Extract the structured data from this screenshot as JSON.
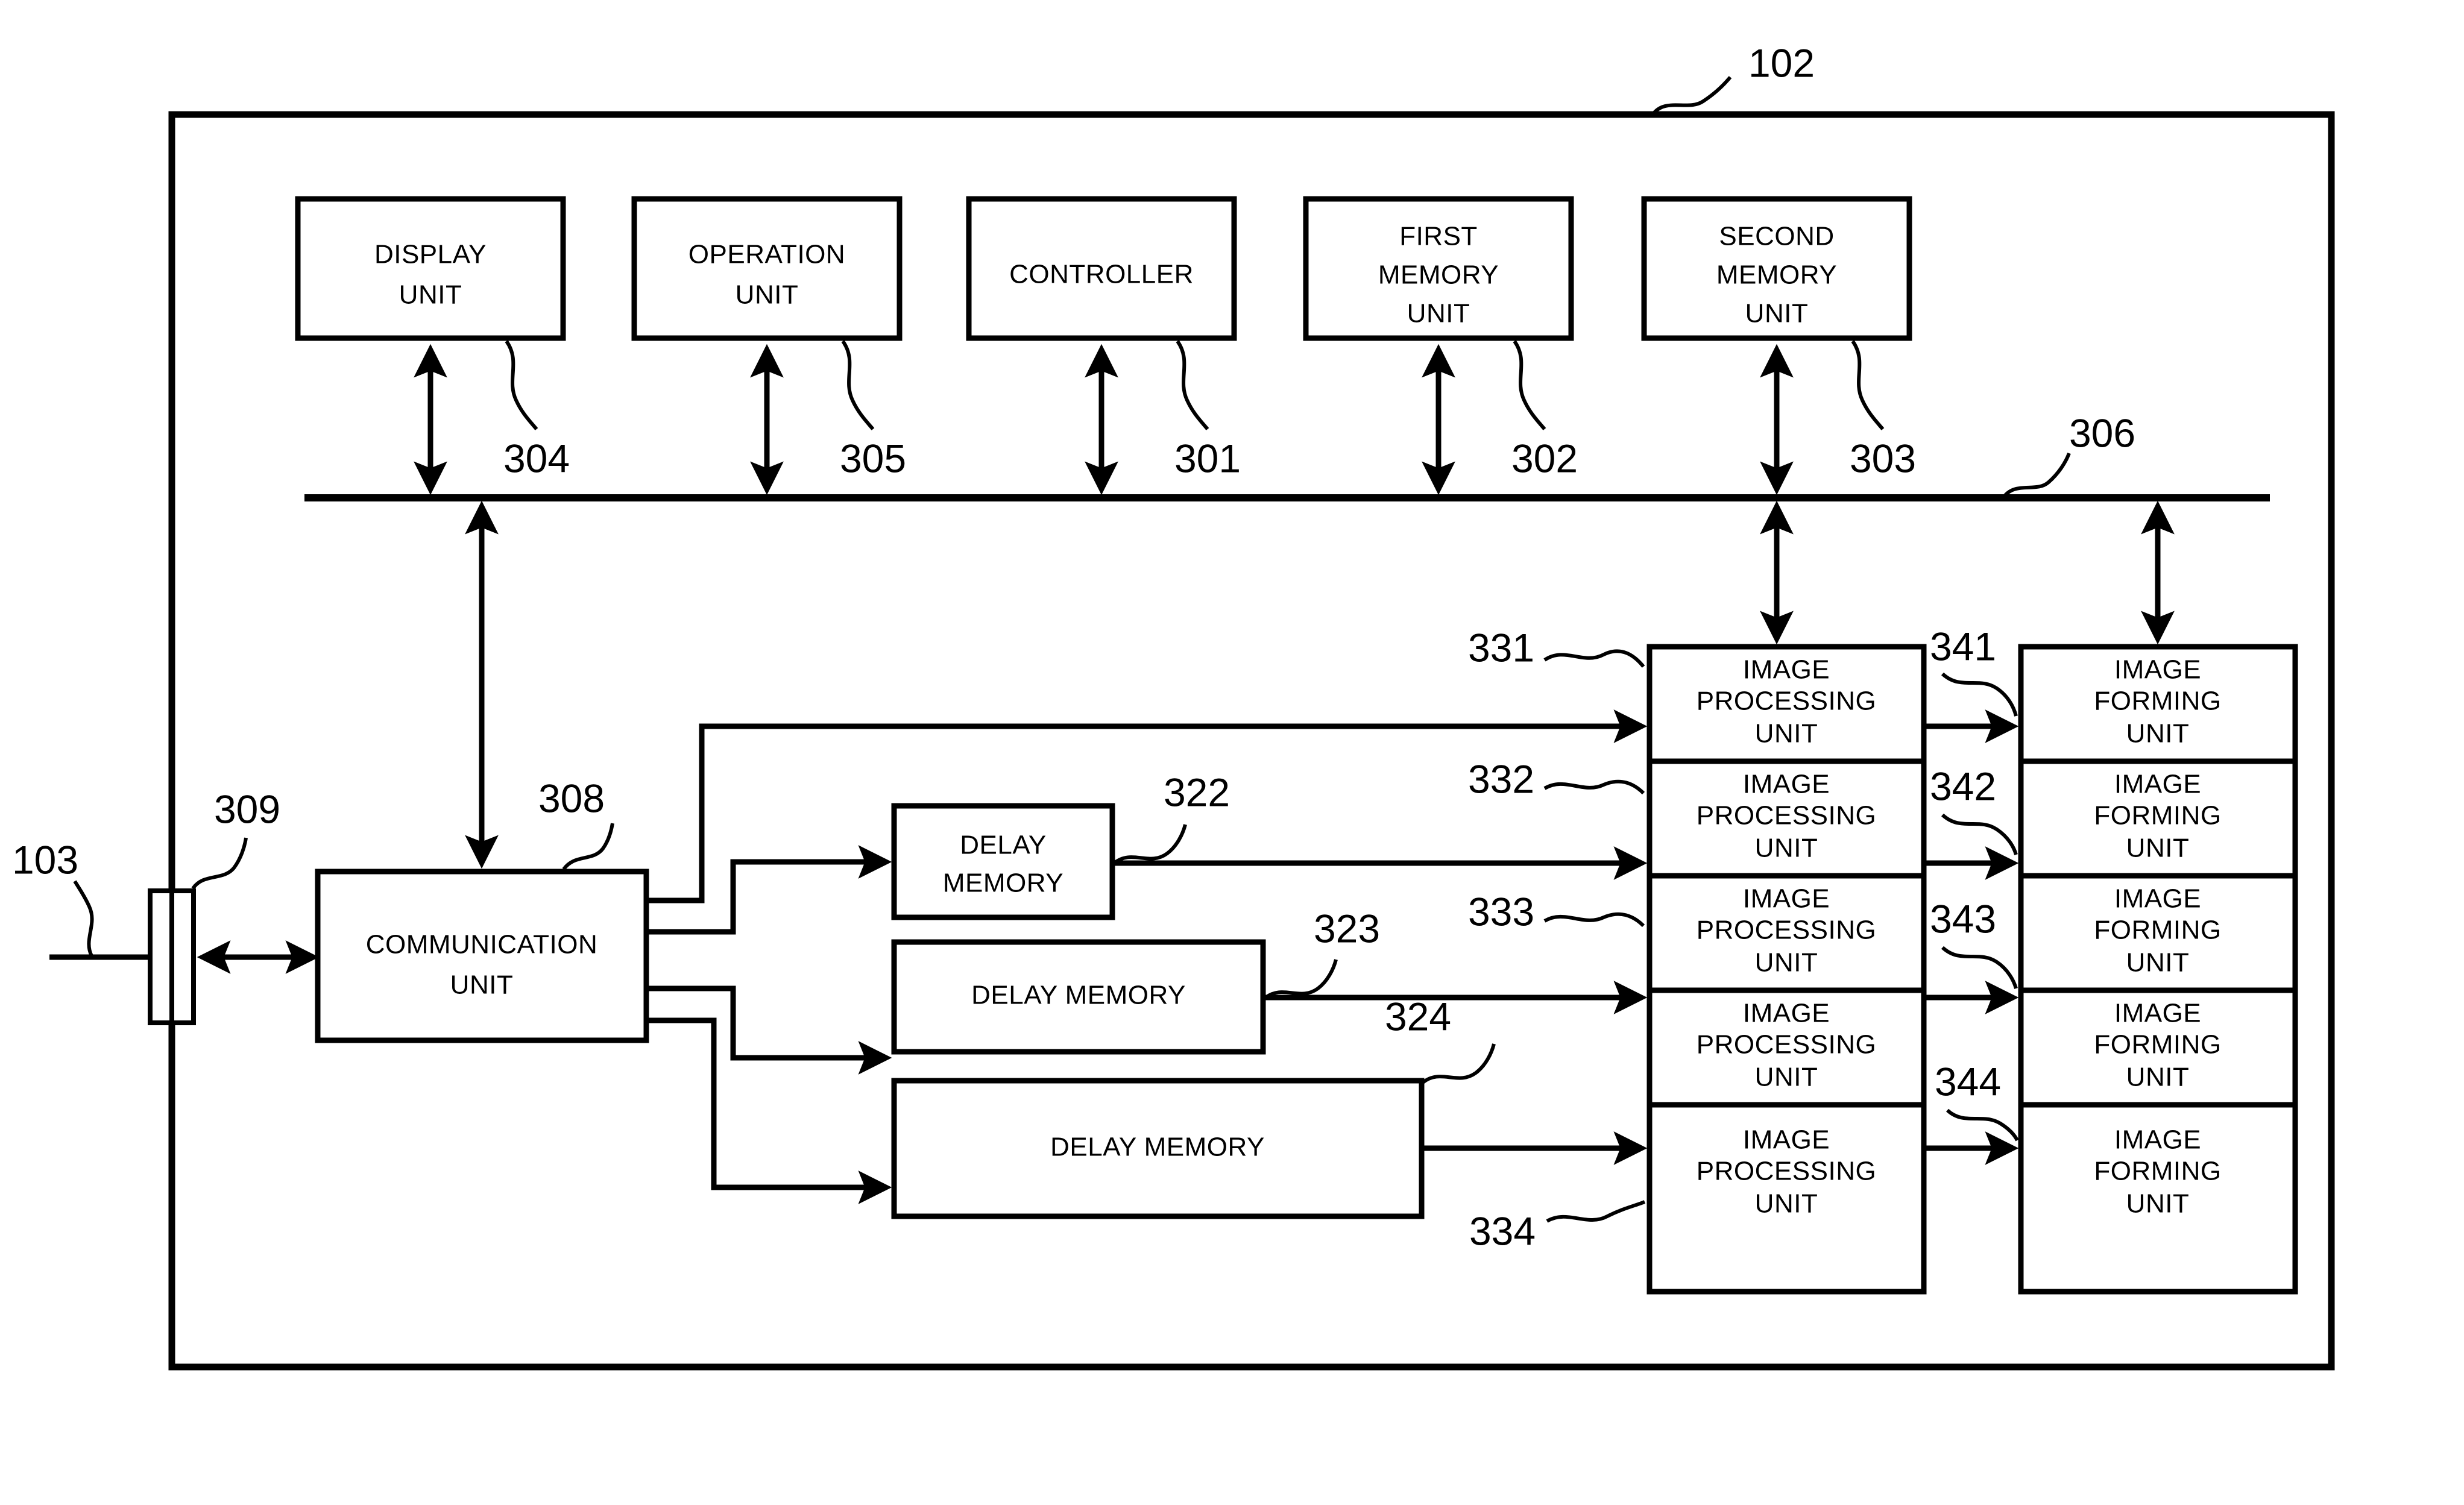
{
  "figure": {
    "outer_ref": "102",
    "external_ref": "103",
    "bus_ref": "306",
    "connector_ref": "309"
  },
  "top_row": [
    {
      "label_line1": "DISPLAY",
      "label_line2": "UNIT",
      "label_line3": "",
      "ref": "304"
    },
    {
      "label_line1": "OPERATION",
      "label_line2": "UNIT",
      "label_line3": "",
      "ref": "305"
    },
    {
      "label_line1": "CONTROLLER",
      "label_line2": "",
      "label_line3": "",
      "ref": "301"
    },
    {
      "label_line1": "FIRST",
      "label_line2": "MEMORY",
      "label_line3": "UNIT",
      "ref": "302"
    },
    {
      "label_line1": "SECOND",
      "label_line2": "MEMORY",
      "label_line3": "UNIT",
      "ref": "303"
    }
  ],
  "communication_unit": {
    "label_line1": "COMMUNICATION",
    "label_line2": "UNIT",
    "ref": "308"
  },
  "delay_memories": [
    {
      "label_line1": "DELAY",
      "label_line2": "MEMORY",
      "single_line": "",
      "ref": "322"
    },
    {
      "label_line1": "",
      "label_line2": "",
      "single_line": "DELAY MEMORY",
      "ref": "323"
    },
    {
      "label_line1": "",
      "label_line2": "",
      "single_line": "DELAY MEMORY",
      "ref": "324"
    }
  ],
  "image_processing_units": [
    {
      "label_line1": "IMAGE",
      "label_line2": "PROCESSING",
      "label_line3": "UNIT",
      "ref": "331"
    },
    {
      "label_line1": "IMAGE",
      "label_line2": "PROCESSING",
      "label_line3": "UNIT",
      "ref": "332"
    },
    {
      "label_line1": "IMAGE",
      "label_line2": "PROCESSING",
      "label_line3": "UNIT",
      "ref": "333"
    },
    {
      "label_line1": "IMAGE",
      "label_line2": "PROCESSING",
      "label_line3": "UNIT",
      "ref": "334"
    }
  ],
  "image_forming_units": [
    {
      "label_line1": "IMAGE",
      "label_line2": "FORMING",
      "label_line3": "UNIT",
      "ref": "341"
    },
    {
      "label_line1": "IMAGE",
      "label_line2": "FORMING",
      "label_line3": "UNIT",
      "ref": "342"
    },
    {
      "label_line1": "IMAGE",
      "label_line2": "FORMING",
      "label_line3": "UNIT",
      "ref": "343"
    },
    {
      "label_line1": "IMAGE",
      "label_line2": "FORMING",
      "label_line3": "UNIT",
      "ref": "344"
    }
  ]
}
